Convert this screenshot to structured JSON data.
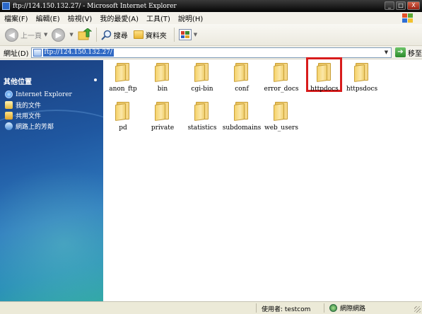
{
  "window": {
    "title": "ftp://124.150.132.27/ - Microsoft Internet Explorer",
    "buttons": {
      "minimize": "_",
      "maximize": "□",
      "close": "X"
    }
  },
  "menu": {
    "items": [
      "檔案(F)",
      "編輯(E)",
      "檢視(V)",
      "我的最愛(A)",
      "工具(T)",
      "說明(H)"
    ]
  },
  "toolbar": {
    "back_label": "上一頁",
    "search_label": "搜尋",
    "folders_label": "資料夾"
  },
  "address": {
    "label": "網址(D)",
    "value": "ftp://124.150.132.27/",
    "go_label": "移至"
  },
  "sidebar": {
    "header": "其他位置",
    "items": [
      {
        "label": "Internet Explorer",
        "icon": "ie-icon"
      },
      {
        "label": "我的文件",
        "icon": "my-documents-icon"
      },
      {
        "label": "共用文件",
        "icon": "shared-documents-icon"
      },
      {
        "label": "網路上的芳鄰",
        "icon": "network-places-icon"
      }
    ]
  },
  "files": [
    {
      "name": "anon_ftp"
    },
    {
      "name": "bin"
    },
    {
      "name": "cgi-bin"
    },
    {
      "name": "conf"
    },
    {
      "name": "error_docs"
    },
    {
      "name": "httpdocs",
      "highlighted": true
    },
    {
      "name": "httpsdocs"
    },
    {
      "name": "pd"
    },
    {
      "name": "private"
    },
    {
      "name": "statistics"
    },
    {
      "name": "subdomains"
    },
    {
      "name": "web_users"
    }
  ],
  "status": {
    "user": "使用者: testcom",
    "zone": "網際網路"
  },
  "colors": {
    "highlight_border": "#d81c1c",
    "address_selection": "#316ac5",
    "titlebar": "#1a1a1a"
  }
}
